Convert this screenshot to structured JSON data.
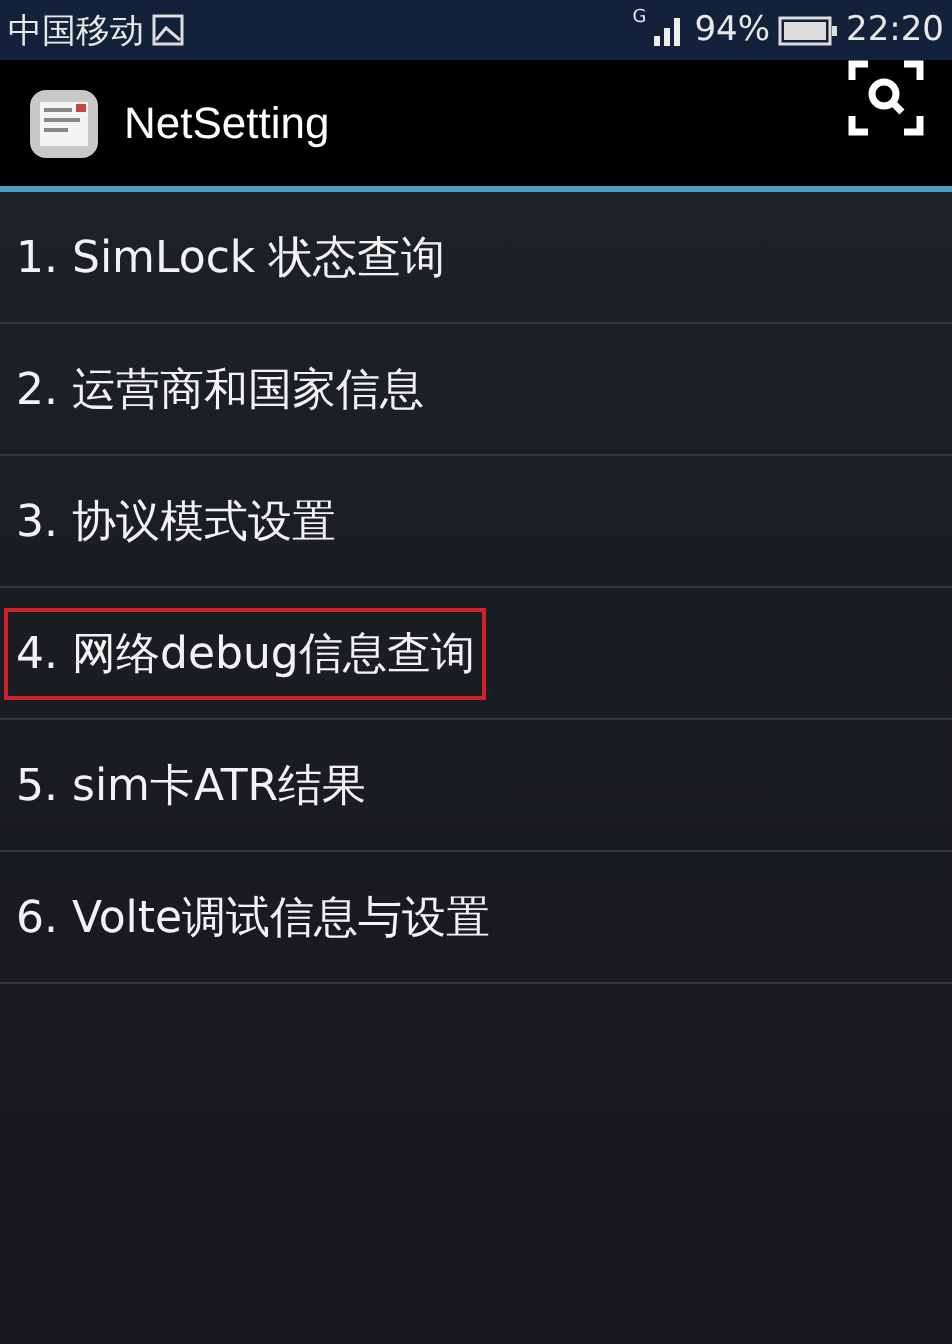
{
  "status_bar": {
    "carrier": "中国移动",
    "network": "G",
    "battery": "94%",
    "time": "22:20"
  },
  "app_bar": {
    "title": "NetSetting"
  },
  "menu": [
    {
      "label": "1. SimLock 状态查询",
      "highlighted": false
    },
    {
      "label": "2. 运营商和国家信息",
      "highlighted": false
    },
    {
      "label": "3. 协议模式设置",
      "highlighted": false
    },
    {
      "label": "4. 网络debug信息查询",
      "highlighted": true
    },
    {
      "label": "5. sim卡ATR结果",
      "highlighted": false
    },
    {
      "label": "6. Volte调试信息与设置",
      "highlighted": false
    }
  ]
}
